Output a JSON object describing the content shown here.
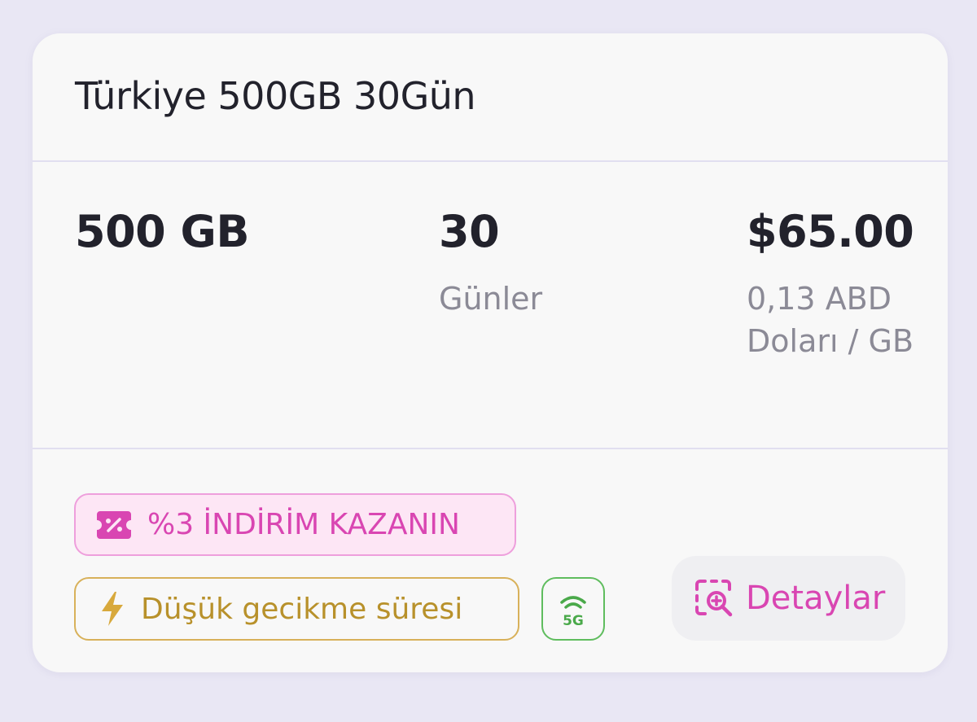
{
  "plan": {
    "title": "Türkiye 500GB 30Gün"
  },
  "stats": {
    "data_amount": "500 GB",
    "duration_value": "30",
    "duration_label": "Günler",
    "price": "$65.00",
    "price_per_gb": "0,13 ABD Doları / GB"
  },
  "tags": {
    "discount_label": "%3 İNDİRİM KAZANIN",
    "latency_label": "Düşük gecikme süresi",
    "network_label": "5G"
  },
  "actions": {
    "details_label": "Detaylar"
  },
  "colors": {
    "accent": "#d946b2",
    "latency": "#b8912b",
    "network": "#4aa94a",
    "text": "#22222c",
    "muted": "#8b8a96"
  },
  "icons": {
    "discount": "discount-ticket-icon",
    "latency": "lightning-icon",
    "network": "signal-5g-icon",
    "details": "zoom-in-icon"
  }
}
